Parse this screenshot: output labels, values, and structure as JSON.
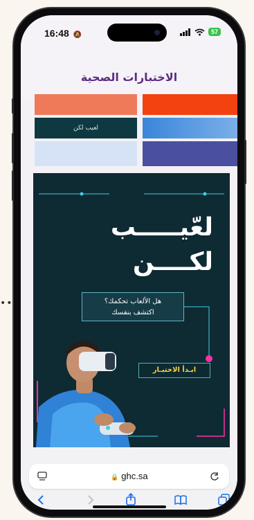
{
  "status_bar": {
    "time": "16:48",
    "battery": "57"
  },
  "page": {
    "title": "الاختبارات الصحية"
  },
  "tiles": {
    "dark_tile_label": "لعيب لكن"
  },
  "banner": {
    "headline_line1": "لعّيـــــب",
    "headline_line2": "لكــــن",
    "question_line1": "هل الألعاب تحكمك؟",
    "question_line2": "اكتشف بنفسك",
    "start_button": "ابـدأ الاختبـار"
  },
  "browser": {
    "url": "ghc.sa"
  },
  "icons": {
    "silent": "bell-slash-icon",
    "signal": "signal-icon",
    "wifi": "wifi-icon",
    "lock": "lock-icon",
    "reload": "reload-icon",
    "tabs_overview": "tabs-icon",
    "back": "back-icon",
    "forward": "forward-icon",
    "share": "share-icon",
    "bookmarks": "bookmarks-icon"
  },
  "colors": {
    "title_purple": "#5b2c84",
    "banner_bg": "#0e2a33",
    "accent_cyan": "#3fd0e0",
    "accent_pink": "#ff2fa6",
    "button_text": "#f7d347",
    "link_blue": "#1b6fe6"
  }
}
